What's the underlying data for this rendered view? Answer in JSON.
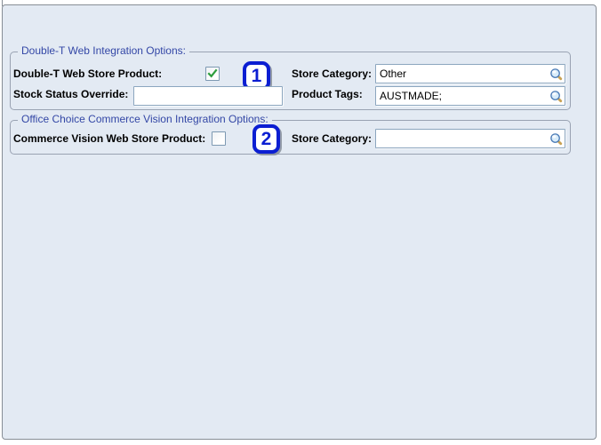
{
  "colors": {
    "panel_bg": "#e3eaf3",
    "legend_blue": "#3347a6",
    "annotation_blue": "#0b1ed2",
    "check_green": "#2e9e3e",
    "input_border": "#8ca6bf"
  },
  "group1": {
    "legend": "Double-T Web Integration Options:",
    "web_store_product_label": "Double-T Web Store Product:",
    "web_store_product_checked": true,
    "stock_status_override_label": "Stock Status Override:",
    "stock_status_override_value": "",
    "store_category_label": "Store Category:",
    "store_category_value": "Other",
    "product_tags_label": "Product Tags:",
    "product_tags_value": "AUSTMADE;"
  },
  "group2": {
    "legend": "Office Choice Commerce Vision Integration Options:",
    "web_store_product_label": "Commerce Vision Web Store Product:",
    "web_store_product_checked": false,
    "store_category_label": "Store Category:",
    "store_category_value": ""
  },
  "annotations": {
    "badge1": "1",
    "badge2": "2"
  }
}
